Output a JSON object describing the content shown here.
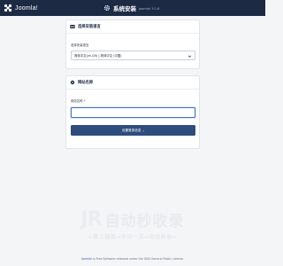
{
  "header": {
    "logo_text": "Joomla!",
    "title": "系统安装",
    "version": "Joomla! 3.1.6"
  },
  "language_card": {
    "heading": "选择安装语言",
    "field_label": "选择安装语言",
    "selected_value": "简体中文(zh-CN) | 简体中文 (中国)"
  },
  "site_card": {
    "heading": "网站名称",
    "field_label": "网站名称 *",
    "input_value": "",
    "button_label": "设置登录信息"
  },
  "watermark": {
    "title": "自动秒收录",
    "subtitle": "←数上链接→来访一次→自动收录←"
  },
  "footer": {
    "link": "Joomla!",
    "text": "is Free Software released under the GNU General Public License."
  }
}
